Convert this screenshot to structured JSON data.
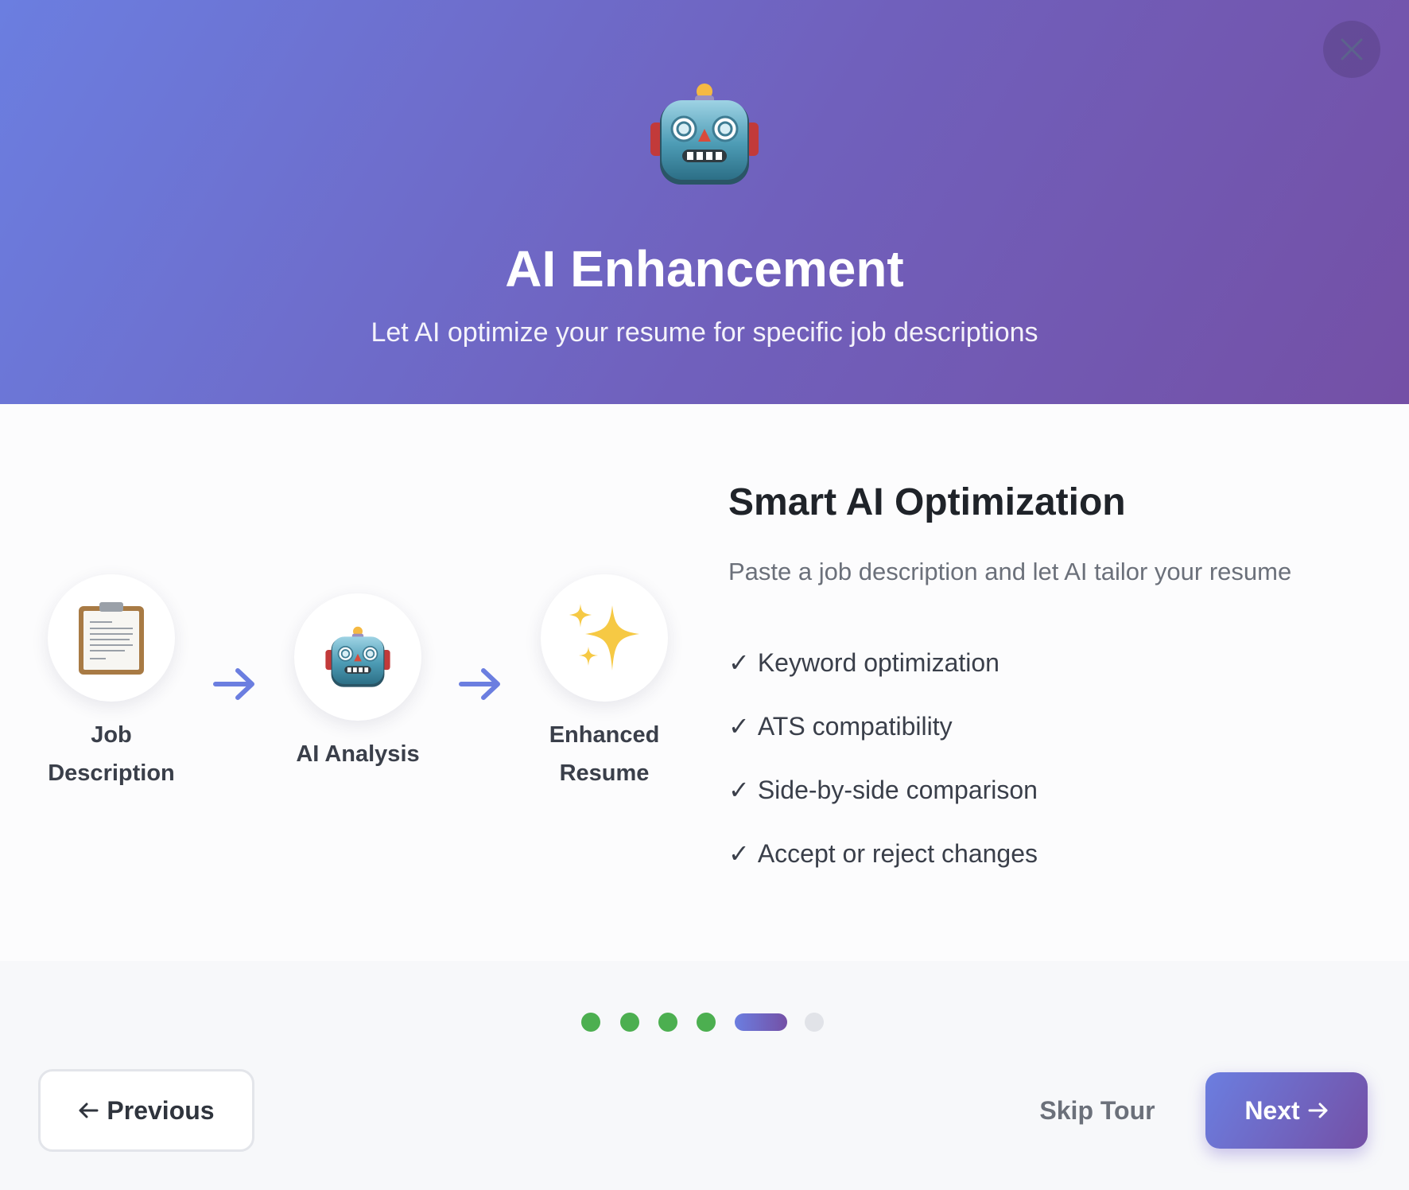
{
  "header": {
    "title": "AI Enhancement",
    "subtitle": "Let AI optimize your resume for specific job descriptions",
    "hero_icon": "robot-icon",
    "gradient": [
      "#6b7ee0",
      "#7450a6"
    ]
  },
  "flow": {
    "steps": [
      {
        "icon": "clipboard-icon",
        "label_line1": "Job",
        "label_line2": "Description"
      },
      {
        "icon": "robot-icon",
        "label": "AI Analysis"
      },
      {
        "icon": "sparkles-icon",
        "label_line1": "Enhanced",
        "label_line2": "Resume"
      }
    ],
    "arrow_icon": "arrow-right-icon",
    "arrow_color": "#6b7ee0"
  },
  "feature": {
    "title": "Smart AI Optimization",
    "description": "Paste a job description and let AI tailor your resume",
    "check_mark": "✓",
    "items": [
      "Keyword optimization",
      "ATS compatibility",
      "Side-by-side comparison",
      "Accept or reject changes"
    ]
  },
  "progress": {
    "total_steps": 6,
    "current_step": 5,
    "done_color": "#4caf50",
    "todo_color": "#e1e3e8"
  },
  "footer": {
    "previous_label": "Previous",
    "skip_label": "Skip Tour",
    "next_label": "Next"
  }
}
